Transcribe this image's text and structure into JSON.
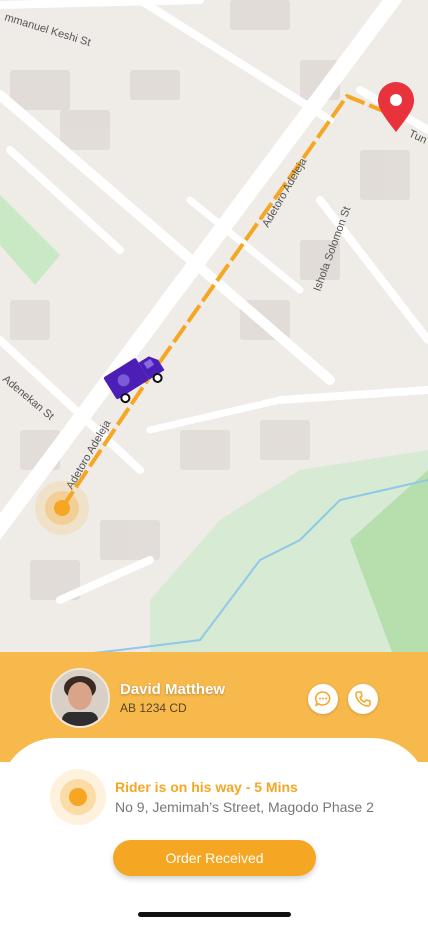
{
  "map": {
    "streets": {
      "keshi": "mmanuel Keshi St",
      "adetoro_upper": "Adetoro Adeleja",
      "adetoro_lower": "Adetoro Adeleja",
      "ishola": "Ishola Solomon St",
      "adenekan": "Adenekan St",
      "tun": "Tun"
    },
    "icons": {
      "destination": "map-pin-icon",
      "vehicle": "delivery-truck-icon",
      "origin": "current-location-pulse-icon"
    },
    "colors": {
      "route": "#f5a623",
      "pin": "#e8323c",
      "vehicle": "#4b1fb5",
      "park": "#c9e9c4",
      "water": "#8fc8e8"
    }
  },
  "driver": {
    "name": "David Matthew",
    "plate": "AB 1234 CD",
    "chat_icon": "chat-bubble-icon",
    "call_icon": "phone-icon"
  },
  "status": {
    "title": "Rider is on his way - 5 Mins",
    "address": "No 9, Jemimah’s Street, Magodo Phase 2",
    "icon": "location-pulse-icon"
  },
  "action": {
    "label": "Order Received"
  },
  "colors": {
    "accent": "#f5a623",
    "panel": "#f7b84c"
  }
}
